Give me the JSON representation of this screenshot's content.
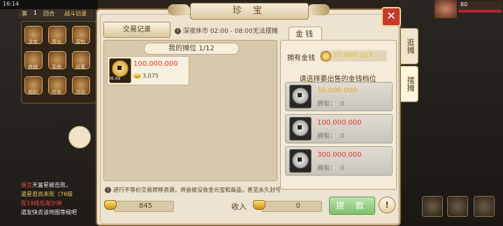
{
  "status_bar": {
    "time": "16:14"
  },
  "game_hud": {
    "turn_prefix": "第",
    "turn_number": "1",
    "turn_suffix": "回合",
    "map_label": "战斗记录",
    "top_right_number": "80",
    "grid_labels": [
      "法宝",
      "帮派",
      "背包",
      "商城",
      "系统",
      "设置",
      "福利",
      "任务",
      "活动",
      "战斗"
    ]
  },
  "chat": {
    "lines": [
      {
        "tag": "谣言",
        "text": "天富星被击败，"
      },
      {
        "tag": "",
        "text": "遣星君尚未败（76级"
      },
      {
        "tag": "",
        "text": "在19线北海沙洲"
      },
      {
        "tag": "",
        "text": "道友快去该地图等候吧"
      }
    ]
  },
  "dialog": {
    "title": "珍 宝",
    "record_button": "交易记录",
    "notice": "深夜休市 02:00 - 08:00无法摆摊",
    "my_stall_label": "我的摊位 1/12",
    "item": {
      "price": "100.000.000",
      "ingot_price": "3,075",
      "timer": "06:49"
    },
    "warning": "进行不等价交易转移资源，将会被没收金元宝和商品，甚至永久封号",
    "balance_value": "845",
    "income_label": "收入",
    "income_value": "0",
    "withdraw_button": "提 款",
    "right_tab": "金钱",
    "own_label": "拥有金钱",
    "own_value": "31.990.333",
    "choose_label": "请选择要出售的金钱档位",
    "tiers": [
      {
        "price": "50.000.000",
        "own_label": "拥有：",
        "own": "0"
      },
      {
        "price": "100.000.000",
        "own_label": "拥有：",
        "own": "0"
      },
      {
        "price": "300.000.000",
        "own_label": "拥有：",
        "own": "0"
      }
    ],
    "side_tabs": [
      "逛摊",
      "摆摊"
    ]
  },
  "colors": {
    "dialog_bg": "#ece3d0",
    "price_red": "#e23a2a",
    "tier1_price": "#e8a81a",
    "gold_text": "#e8c13a",
    "withdraw_green": "#7dbf6a",
    "close_red": "#c73a28"
  },
  "icons": [
    "close-icon",
    "info-icon",
    "coin-icon",
    "ingot-icon",
    "silver-coin-icon",
    "exclamation-icon"
  ]
}
